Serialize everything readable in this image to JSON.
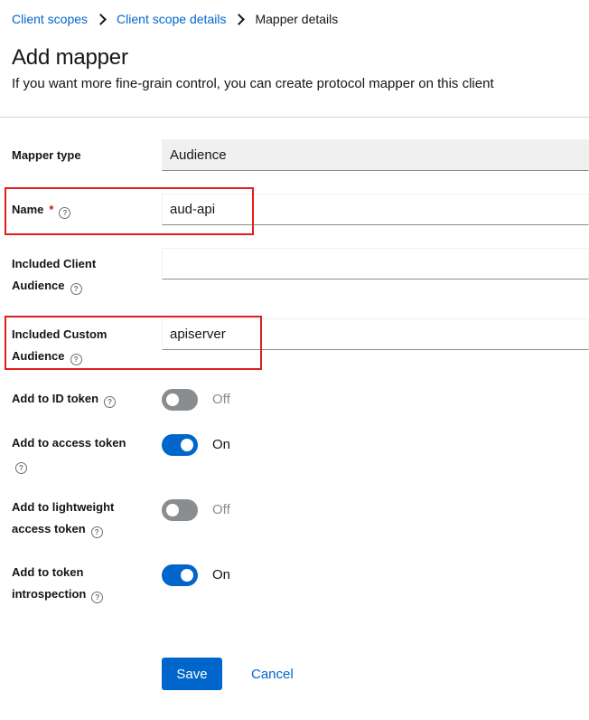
{
  "breadcrumb": {
    "items": [
      {
        "label": "Client scopes"
      },
      {
        "label": "Client scope details"
      },
      {
        "label": "Mapper details"
      }
    ]
  },
  "header": {
    "title": "Add mapper",
    "subtitle": "If you want more fine-grain control, you can create protocol mapper on this client"
  },
  "form": {
    "mapper_type": {
      "label": "Mapper type",
      "value": "Audience"
    },
    "name": {
      "label": "Name",
      "required_mark": "*",
      "value": "aud-api"
    },
    "included_client_audience": {
      "label_line1": "Included Client",
      "label_line2": "Audience",
      "value": ""
    },
    "included_custom_audience": {
      "label_line1": "Included Custom",
      "label_line2": "Audience",
      "value": "apiserver"
    },
    "add_to_id_token": {
      "label": "Add to ID token",
      "state": "Off"
    },
    "add_to_access_token": {
      "label": "Add to access token",
      "state": "On"
    },
    "add_to_lightweight_access_token": {
      "label_line1": "Add to lightweight",
      "label_line2": "access token",
      "state": "Off"
    },
    "add_to_token_introspection": {
      "label_line1": "Add to token",
      "label_line2": "introspection",
      "state": "On"
    }
  },
  "help_glyph": "?",
  "actions": {
    "save_label": "Save",
    "cancel_label": "Cancel"
  },
  "colors": {
    "accent": "#0066cc",
    "highlight": "#e01e1e",
    "switch_off": "#8a8d90"
  }
}
